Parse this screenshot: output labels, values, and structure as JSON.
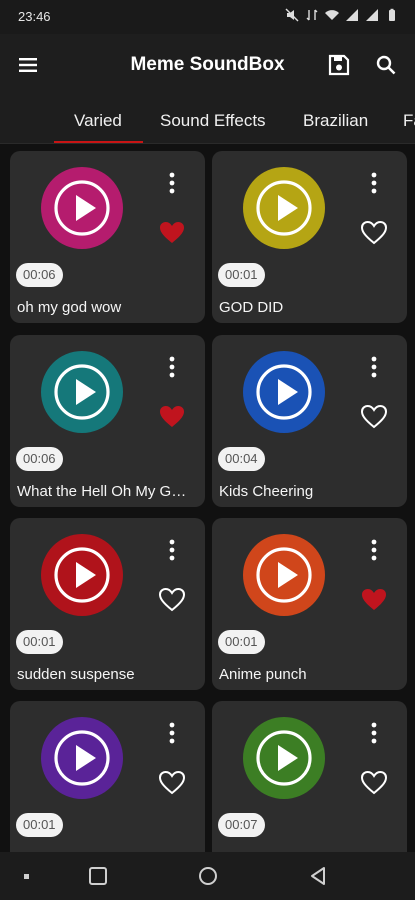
{
  "status_bar": {
    "time": "23:46"
  },
  "app_bar": {
    "title": "Meme SoundBox"
  },
  "tabs": [
    {
      "label": "Varied",
      "active": true
    },
    {
      "label": "Sound Effects",
      "active": false
    },
    {
      "label": "Brazilian",
      "active": false
    },
    {
      "label": "Fa",
      "active": false
    }
  ],
  "colors": {
    "accent": "#c81414",
    "favorite_filled": "#c0141e",
    "card_bg": "#2d2d2d"
  },
  "sounds": [
    {
      "name": "oh my god  wow",
      "duration": "00:06",
      "color": "#b51c6e",
      "favorite": true
    },
    {
      "name": "GOD DID",
      "duration": "00:01",
      "color": "#b5a514",
      "favorite": false
    },
    {
      "name": "What the Hell Oh My G…",
      "duration": "00:06",
      "color": "#15787a",
      "favorite": true
    },
    {
      "name": "Kids Cheering",
      "duration": "00:04",
      "color": "#1a52b5",
      "favorite": false
    },
    {
      "name": "sudden suspense",
      "duration": "00:01",
      "color": "#b0131b",
      "favorite": false
    },
    {
      "name": "Anime punch",
      "duration": "00:01",
      "color": "#d0461b",
      "favorite": true
    },
    {
      "name": "",
      "duration": "00:01",
      "color": "#5a2398",
      "favorite": false
    },
    {
      "name": "",
      "duration": "00:07",
      "color": "#3c7e24",
      "favorite": false
    }
  ]
}
